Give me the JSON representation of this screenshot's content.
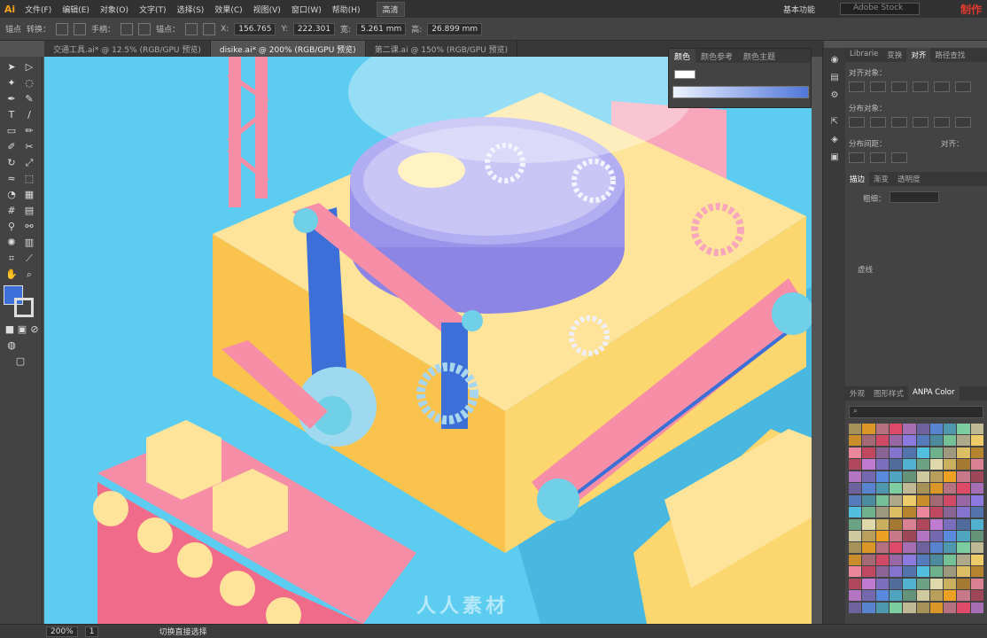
{
  "menubar": {
    "logo": "Ai",
    "items": [
      "文件(F)",
      "编辑(E)",
      "对象(O)",
      "文字(T)",
      "选择(S)",
      "效果(C)",
      "视图(V)",
      "窗口(W)",
      "帮助(H)"
    ],
    "mode": "高清",
    "workspace": "基本功能",
    "search_placeholder": "Adobe Stock",
    "brand": "制作"
  },
  "controlbar": {
    "label_anchor": "锚点",
    "label_convert": "转换：",
    "label_handle": "手柄：",
    "label_anchor2": "锚点：",
    "x_label": "X:",
    "x_value": "156.765",
    "y_label": "Y:",
    "y_value": "222.301",
    "w_label": "宽:",
    "w_value": "5.261 mm",
    "h_label": "高:",
    "h_value": "26.899 mm"
  },
  "tabs": [
    {
      "label": "交通工具.ai* @ 12.5% (RGB/GPU 预览)",
      "active": false
    },
    {
      "label": "disike.ai* @ 200% (RGB/GPU 预览)",
      "active": true
    },
    {
      "label": "第二课.ai @ 150% (RGB/GPU 预览)",
      "active": false
    }
  ],
  "colorpanel": {
    "tabs": [
      "颜色",
      "颜色参考",
      "颜色主题"
    ]
  },
  "rightpanel": {
    "top_tabs": [
      "Librarie",
      "变换",
      "对齐",
      "路径查找"
    ],
    "align_objects": "对齐对象：",
    "distribute_objects": "分布对象：",
    "distribute_spacing": "分布间距：",
    "align_to": "对齐：",
    "stroke_tabs": [
      "描边",
      "渐变",
      "透明度"
    ],
    "stroke_weight_label": "粗细：",
    "dash_label": "虚线",
    "bottom_tabs": [
      "外观",
      "图形样式",
      "ANPA Color"
    ]
  },
  "statusbar": {
    "zoom": "200%",
    "artboard": "1",
    "tool": "切换直接选择"
  },
  "watermark": "人人素材",
  "colors": {
    "canvas": "#5ccdf0",
    "yellow": "#fde49a",
    "pink": "#f58ea6",
    "purple": "#a9a3ee",
    "blue": "#3c6fd8"
  }
}
